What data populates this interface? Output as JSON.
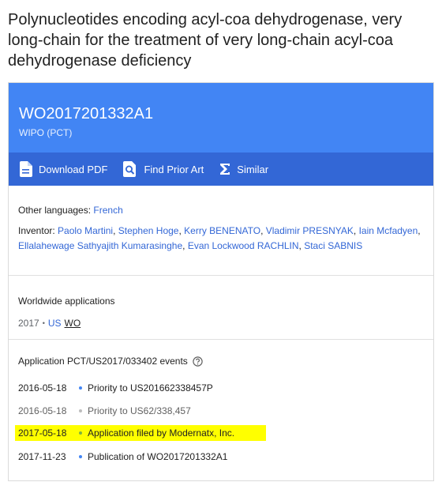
{
  "title": "Polynucleotides encoding acyl-coa dehydrogenase, very long-chain for the treatment of very long-chain acyl-coa dehydrogenase deficiency",
  "header": {
    "publication_number": "WO2017201332A1",
    "office": "WIPO (PCT)"
  },
  "actions": [
    {
      "label": "Download PDF",
      "icon": "pdf-file-icon"
    },
    {
      "label": "Find Prior Art",
      "icon": "search-document-icon"
    },
    {
      "label": "Similar",
      "icon": "sigma-icon"
    }
  ],
  "languages": {
    "label": "Other languages:",
    "value": "French"
  },
  "inventor": {
    "label": "Inventor:",
    "names": [
      "Paolo Martini",
      "Stephen Hoge",
      "Kerry BENENATO",
      "Vladimir PRESNYAK",
      "Iain Mcfadyen",
      "Ellalahewage Sathyajith Kumarasinghe",
      "Evan Lockwood RACHLIN",
      "Staci SABNIS"
    ]
  },
  "worldwide": {
    "title": "Worldwide applications",
    "year": "2017",
    "countries": [
      "US",
      "WO"
    ]
  },
  "events": {
    "title": "Application PCT/US2017/033402 events",
    "items": [
      {
        "date": "2016-05-18",
        "text": "Priority to US201662338457P",
        "dot_color": "#4285f4",
        "dim": false,
        "highlight": false
      },
      {
        "date": "2016-05-18",
        "text": "Priority to US62/338,457",
        "dot_color": "#bdbdbd",
        "dim": true,
        "highlight": false
      },
      {
        "date": "2017-05-18",
        "text": "Application filed by Modernatx, Inc.",
        "dot_color": "#7cb342",
        "dim": false,
        "highlight": true
      },
      {
        "date": "2017-11-23",
        "text": "Publication of WO2017201332A1",
        "dot_color": "#4285f4",
        "dim": false,
        "highlight": false
      }
    ]
  },
  "colors": {
    "header": "#4285f4",
    "action_bar": "#3367d6",
    "link": "#3367d6",
    "highlight": "#ffff00"
  }
}
